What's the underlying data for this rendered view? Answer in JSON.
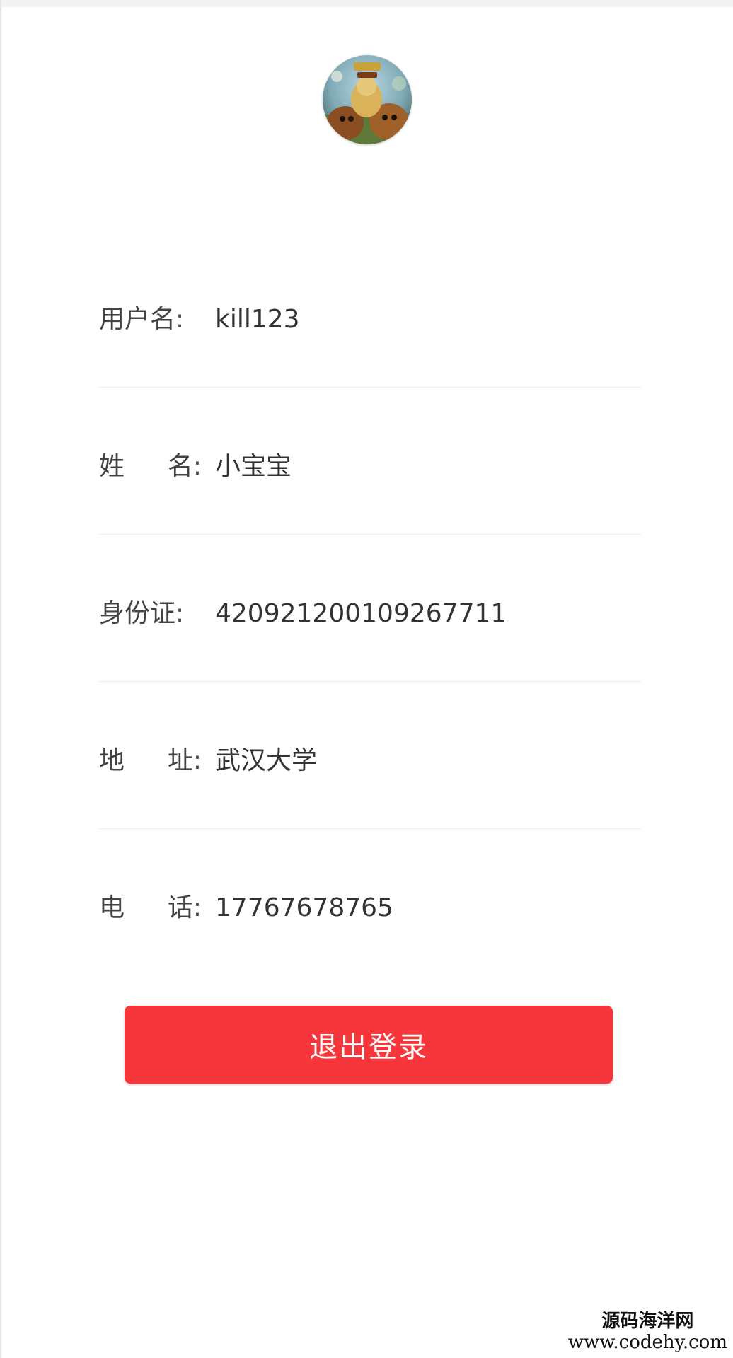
{
  "profile": {
    "avatar_icon": "user-avatar-cartoon-bears"
  },
  "info_rows": [
    {
      "label": "用户名:",
      "value": "kill123"
    },
    {
      "label_chars": [
        "姓",
        "名:"
      ],
      "value": "小宝宝"
    },
    {
      "label": "身份证:",
      "value": "420921200109267711"
    },
    {
      "label_chars": [
        "地",
        "址:"
      ],
      "value": "武汉大学"
    },
    {
      "label_chars": [
        "电",
        "话:"
      ],
      "value": "17767678765"
    }
  ],
  "logout_button": {
    "label": "退出登录",
    "color": "#f7363b"
  },
  "watermark": {
    "line1": "源码海洋网",
    "line2": "www.codehy.com"
  }
}
